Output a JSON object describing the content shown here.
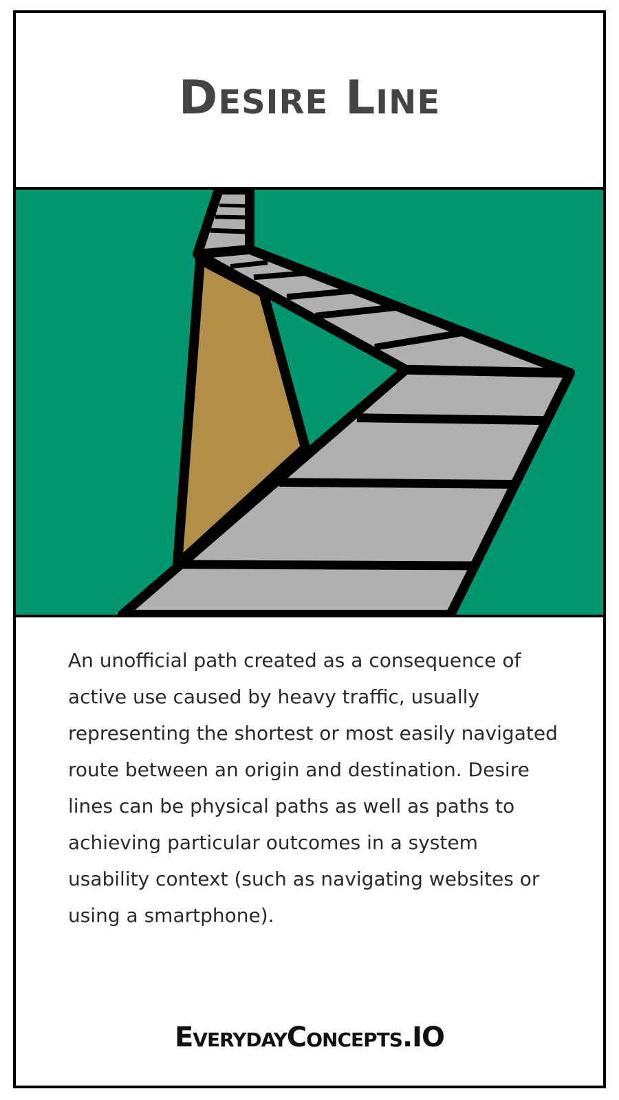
{
  "title": "Desire Line",
  "description": "An unofficial path created as a consequence of active use caused by heavy traffic, usually representing the shortest or most easily navigated route between an origin and destination. Desire lines can be physical paths as well as paths to achieving particular outcomes in a system usability context (such as navigating websites or using a smartphone).",
  "brand": "EverydayConcepts.IO",
  "colors": {
    "grass": "#009670",
    "path": "#b0b0b0",
    "shortcut": "#b18f48",
    "outline": "#000000",
    "title": "#444444"
  },
  "illustration": {
    "icon": "paved-path-with-shortcut-icon"
  }
}
